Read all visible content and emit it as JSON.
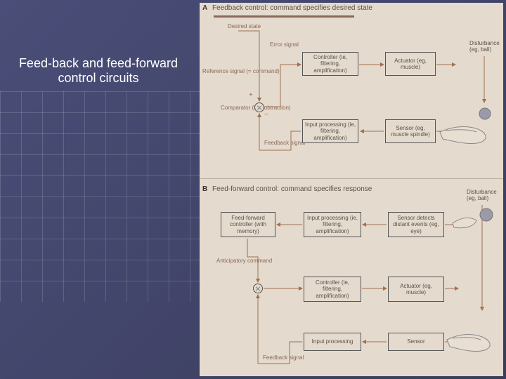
{
  "slide": {
    "title": "Feed-back and feed-forward control circuits"
  },
  "panelA": {
    "letter": "A",
    "header": "Feedback control: command specifies desired state",
    "desired_state": "Desired state",
    "reference": "Reference\nsignal\n(= command)",
    "error": "Error\nsignal",
    "comparator": "Comparator\n(ie, subtraction)",
    "feedback": "Feedback\nsignal",
    "plus": "+",
    "minus": "−",
    "boxes": {
      "controller": "Controller\n(ie, filtering,\namplification)",
      "actuator": "Actuator\n(eg, muscle)",
      "input": "Input processing\n(ie, filtering,\namplification)",
      "sensor": "Sensor\n(eg, muscle\nspindle)"
    },
    "disturbance": "Disturbance\n(eg, ball)"
  },
  "panelB": {
    "letter": "B",
    "header": "Feed-forward control: command specifies response",
    "anticipatory": "Anticipatory\ncommand",
    "feedback": "Feedback\nsignal",
    "boxes": {
      "ffcontroller": "Feed-forward\ncontroller\n(with memory)",
      "ffinput": "Input processing\n(ie, filtering,\namplification)",
      "ffsensor": "Sensor detects\ndistant events\n(eg, eye)",
      "controller": "Controller\n(ie, filtering,\namplification)",
      "actuator": "Actuator\n(eg, muscle)",
      "input": "Input processing",
      "sensor": "Sensor"
    },
    "disturbance": "Disturbance\n(eg, ball)"
  }
}
